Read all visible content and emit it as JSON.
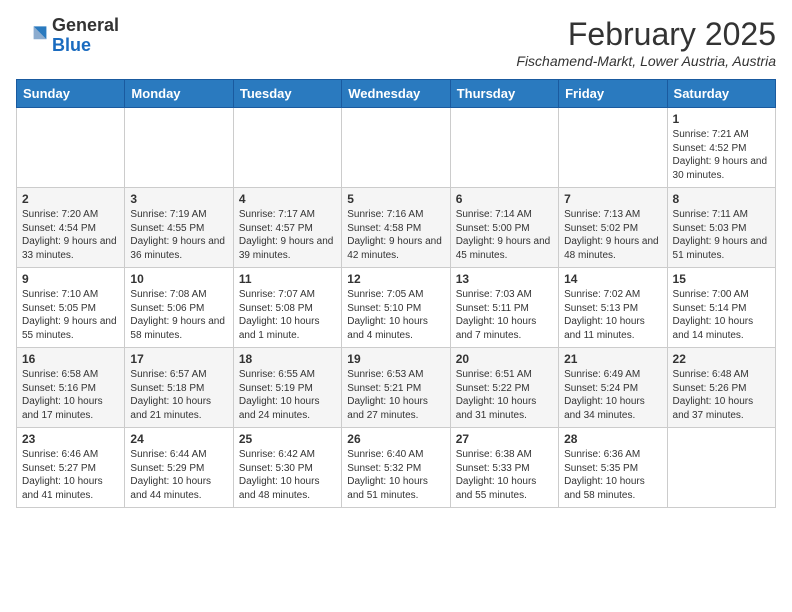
{
  "header": {
    "logo_general": "General",
    "logo_blue": "Blue",
    "month_year": "February 2025",
    "location": "Fischamend-Markt, Lower Austria, Austria"
  },
  "weekdays": [
    "Sunday",
    "Monday",
    "Tuesday",
    "Wednesday",
    "Thursday",
    "Friday",
    "Saturday"
  ],
  "weeks": [
    [
      {
        "day": "",
        "info": ""
      },
      {
        "day": "",
        "info": ""
      },
      {
        "day": "",
        "info": ""
      },
      {
        "day": "",
        "info": ""
      },
      {
        "day": "",
        "info": ""
      },
      {
        "day": "",
        "info": ""
      },
      {
        "day": "1",
        "info": "Sunrise: 7:21 AM\nSunset: 4:52 PM\nDaylight: 9 hours and 30 minutes."
      }
    ],
    [
      {
        "day": "2",
        "info": "Sunrise: 7:20 AM\nSunset: 4:54 PM\nDaylight: 9 hours and 33 minutes."
      },
      {
        "day": "3",
        "info": "Sunrise: 7:19 AM\nSunset: 4:55 PM\nDaylight: 9 hours and 36 minutes."
      },
      {
        "day": "4",
        "info": "Sunrise: 7:17 AM\nSunset: 4:57 PM\nDaylight: 9 hours and 39 minutes."
      },
      {
        "day": "5",
        "info": "Sunrise: 7:16 AM\nSunset: 4:58 PM\nDaylight: 9 hours and 42 minutes."
      },
      {
        "day": "6",
        "info": "Sunrise: 7:14 AM\nSunset: 5:00 PM\nDaylight: 9 hours and 45 minutes."
      },
      {
        "day": "7",
        "info": "Sunrise: 7:13 AM\nSunset: 5:02 PM\nDaylight: 9 hours and 48 minutes."
      },
      {
        "day": "8",
        "info": "Sunrise: 7:11 AM\nSunset: 5:03 PM\nDaylight: 9 hours and 51 minutes."
      }
    ],
    [
      {
        "day": "9",
        "info": "Sunrise: 7:10 AM\nSunset: 5:05 PM\nDaylight: 9 hours and 55 minutes."
      },
      {
        "day": "10",
        "info": "Sunrise: 7:08 AM\nSunset: 5:06 PM\nDaylight: 9 hours and 58 minutes."
      },
      {
        "day": "11",
        "info": "Sunrise: 7:07 AM\nSunset: 5:08 PM\nDaylight: 10 hours and 1 minute."
      },
      {
        "day": "12",
        "info": "Sunrise: 7:05 AM\nSunset: 5:10 PM\nDaylight: 10 hours and 4 minutes."
      },
      {
        "day": "13",
        "info": "Sunrise: 7:03 AM\nSunset: 5:11 PM\nDaylight: 10 hours and 7 minutes."
      },
      {
        "day": "14",
        "info": "Sunrise: 7:02 AM\nSunset: 5:13 PM\nDaylight: 10 hours and 11 minutes."
      },
      {
        "day": "15",
        "info": "Sunrise: 7:00 AM\nSunset: 5:14 PM\nDaylight: 10 hours and 14 minutes."
      }
    ],
    [
      {
        "day": "16",
        "info": "Sunrise: 6:58 AM\nSunset: 5:16 PM\nDaylight: 10 hours and 17 minutes."
      },
      {
        "day": "17",
        "info": "Sunrise: 6:57 AM\nSunset: 5:18 PM\nDaylight: 10 hours and 21 minutes."
      },
      {
        "day": "18",
        "info": "Sunrise: 6:55 AM\nSunset: 5:19 PM\nDaylight: 10 hours and 24 minutes."
      },
      {
        "day": "19",
        "info": "Sunrise: 6:53 AM\nSunset: 5:21 PM\nDaylight: 10 hours and 27 minutes."
      },
      {
        "day": "20",
        "info": "Sunrise: 6:51 AM\nSunset: 5:22 PM\nDaylight: 10 hours and 31 minutes."
      },
      {
        "day": "21",
        "info": "Sunrise: 6:49 AM\nSunset: 5:24 PM\nDaylight: 10 hours and 34 minutes."
      },
      {
        "day": "22",
        "info": "Sunrise: 6:48 AM\nSunset: 5:26 PM\nDaylight: 10 hours and 37 minutes."
      }
    ],
    [
      {
        "day": "23",
        "info": "Sunrise: 6:46 AM\nSunset: 5:27 PM\nDaylight: 10 hours and 41 minutes."
      },
      {
        "day": "24",
        "info": "Sunrise: 6:44 AM\nSunset: 5:29 PM\nDaylight: 10 hours and 44 minutes."
      },
      {
        "day": "25",
        "info": "Sunrise: 6:42 AM\nSunset: 5:30 PM\nDaylight: 10 hours and 48 minutes."
      },
      {
        "day": "26",
        "info": "Sunrise: 6:40 AM\nSunset: 5:32 PM\nDaylight: 10 hours and 51 minutes."
      },
      {
        "day": "27",
        "info": "Sunrise: 6:38 AM\nSunset: 5:33 PM\nDaylight: 10 hours and 55 minutes."
      },
      {
        "day": "28",
        "info": "Sunrise: 6:36 AM\nSunset: 5:35 PM\nDaylight: 10 hours and 58 minutes."
      },
      {
        "day": "",
        "info": ""
      }
    ]
  ]
}
